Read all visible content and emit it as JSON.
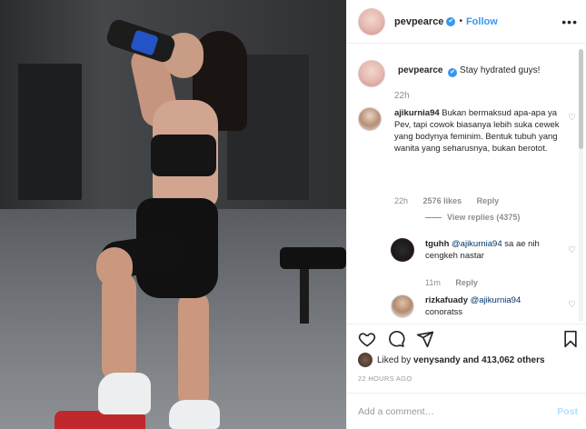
{
  "post": {
    "username": "pevpearce",
    "verified_mark": "✔",
    "separator": "•",
    "follow_label": "Follow",
    "more_label": "•••",
    "caption": "Stay hydrated guys!",
    "caption_time": "22h"
  },
  "comments": [
    {
      "username": "ajikurnia94",
      "text": "Bukan bermaksud apa-apa ya Pev, tapi cowok biasanya lebih suka cewek yang bodynya feminim. Bentuk tubuh yang wanita yang seharusnya, bukan berotot.",
      "time": "22h",
      "likes": "2576 likes",
      "reply_label": "Reply",
      "view_replies": "View replies (4375)"
    }
  ],
  "replies": [
    {
      "username": "tguhh",
      "mention": "@ajikurnia94",
      "text": "sa ae nih cengkeh nastar",
      "time": "11m",
      "reply_label": "Reply"
    },
    {
      "username": "rizkafuady",
      "mention": "@ajikurnia94",
      "text": "conoratss"
    }
  ],
  "likes": {
    "prefix": "Liked by",
    "user": "venysandy",
    "suffix": "and 413,062 others"
  },
  "time_ago": "22 HOURS AGO",
  "add_comment": {
    "placeholder": "Add a comment…",
    "post_label": "Post"
  },
  "icons": {
    "heart": "heart-icon",
    "comment": "comment-icon",
    "share": "share-icon",
    "bookmark": "bookmark-icon"
  },
  "colors": {
    "accent": "#3897f0",
    "text": "#262626",
    "muted": "#8e8e8e",
    "post_disabled": "#b2dffc"
  }
}
